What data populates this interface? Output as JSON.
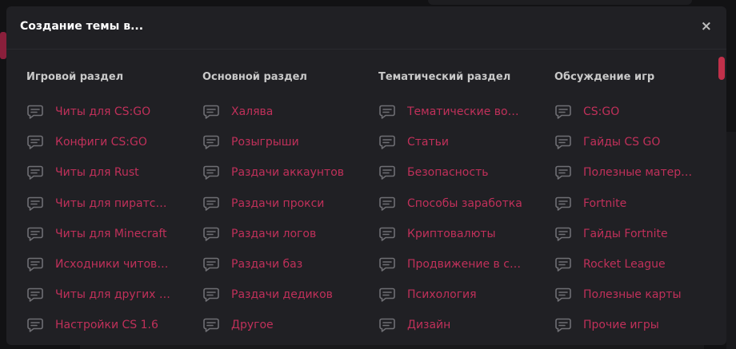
{
  "modal": {
    "title": "Создание темы в...",
    "close": "×"
  },
  "columns": [
    {
      "title": "Игровой раздел",
      "items": [
        "Читы для CS:GO",
        "Конфиги CS:GO",
        "Читы для Rust",
        "Читы для пиратских игр",
        "Читы для Minecraft",
        "Исходники читов и софта",
        "Читы для других игр",
        "Настройки CS 1.6"
      ]
    },
    {
      "title": "Основной раздел",
      "items": [
        "Халява",
        "Розыгрыши",
        "Раздачи аккаунтов",
        "Раздачи прокси",
        "Раздачи логов",
        "Раздачи баз",
        "Раздачи дедиков",
        "Другое"
      ]
    },
    {
      "title": "Тематический раздел",
      "items": [
        "Тематические вопросы",
        "Статьи",
        "Безопасность",
        "Способы заработка",
        "Криптовалюты",
        "Продвижение в соцсетях",
        "Психология",
        "Дизайн"
      ]
    },
    {
      "title": "Обсуждение игр",
      "items": [
        "CS:GO",
        "Гайды CS GO",
        "Полезные материалы",
        "Fortnite",
        "Гайды Fortnite",
        "Rocket League",
        "Полезные карты",
        "Прочие игры"
      ]
    }
  ],
  "icon": "chat-bubble-icon",
  "colors": {
    "modal_bg": "#202024",
    "link": "#c0305a",
    "heading": "#c9c9c9",
    "title": "#ffffff",
    "scrollbar": "#c0304a"
  }
}
